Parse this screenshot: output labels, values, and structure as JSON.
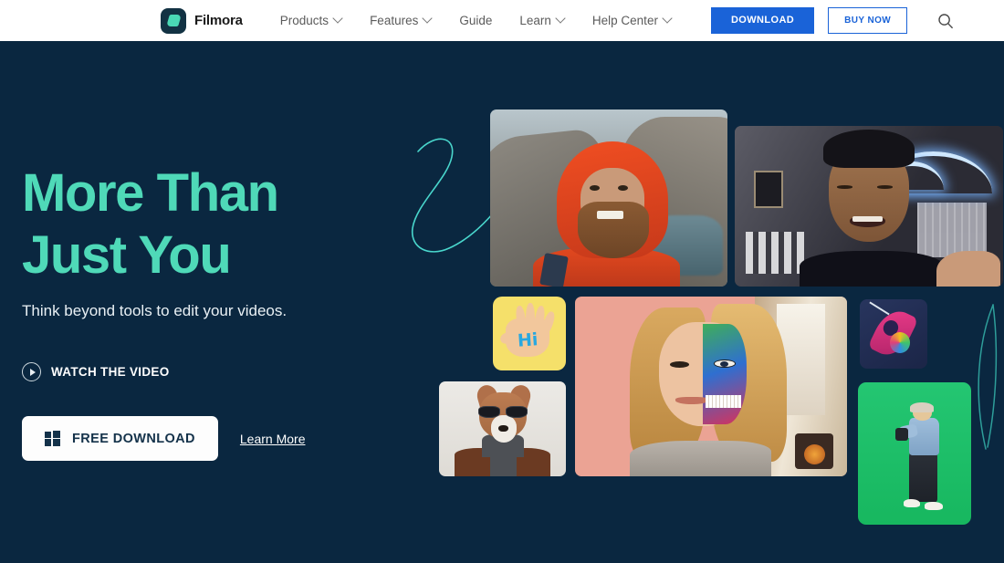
{
  "nav": {
    "logo_icon": "filmora-logo-icon",
    "brand": "Filmora",
    "items": [
      {
        "label": "Products",
        "has_caret": true
      },
      {
        "label": "Features",
        "has_caret": true
      },
      {
        "label": "Guide",
        "has_caret": false
      },
      {
        "label": "Learn",
        "has_caret": true
      },
      {
        "label": "Help Center",
        "has_caret": true
      }
    ],
    "download_label": "DOWNLOAD",
    "buy_label": "BUY NOW",
    "search_icon": "search-icon"
  },
  "hero": {
    "headline_line1": "More Than",
    "headline_line2": "Just You",
    "subhead": "Think beyond tools to edit your videos.",
    "watch_label": "WATCH THE VIDEO",
    "watch_icon": "play-circle-icon",
    "free_download_label": "FREE DOWNLOAD",
    "free_download_icon": "windows-icon",
    "learn_more_label": "Learn More"
  },
  "gallery": {
    "tiles": [
      {
        "id": "tile-hiker",
        "name": "hiker-in-red-hoodie-video-thumbnail"
      },
      {
        "id": "tile-neon",
        "name": "man-with-neon-wave-light-video-thumbnail"
      },
      {
        "id": "tile-hand",
        "name": "hi-waving-hand-sticker"
      },
      {
        "id": "tile-dog",
        "name": "dog-with-sunglasses-thumbnail"
      },
      {
        "id": "tile-face",
        "name": "woman-with-split-face-paint-thumbnail"
      },
      {
        "id": "tile-rocket",
        "name": "rocket-effect-icon"
      },
      {
        "id": "tile-green",
        "name": "green-screen-person-thumbnail"
      }
    ]
  },
  "decor": {
    "left_squiggle": "teal-curved-squiggle",
    "right_squiggle": "teal-curved-squiggle"
  },
  "colors": {
    "background": "#0a2740",
    "headline_teal": "#4fd9b8",
    "accent_blue": "#1a63d8",
    "nav_background": "#ffffff",
    "nav_text": "#5b5b5b",
    "button_white": "#fdfdfd"
  }
}
